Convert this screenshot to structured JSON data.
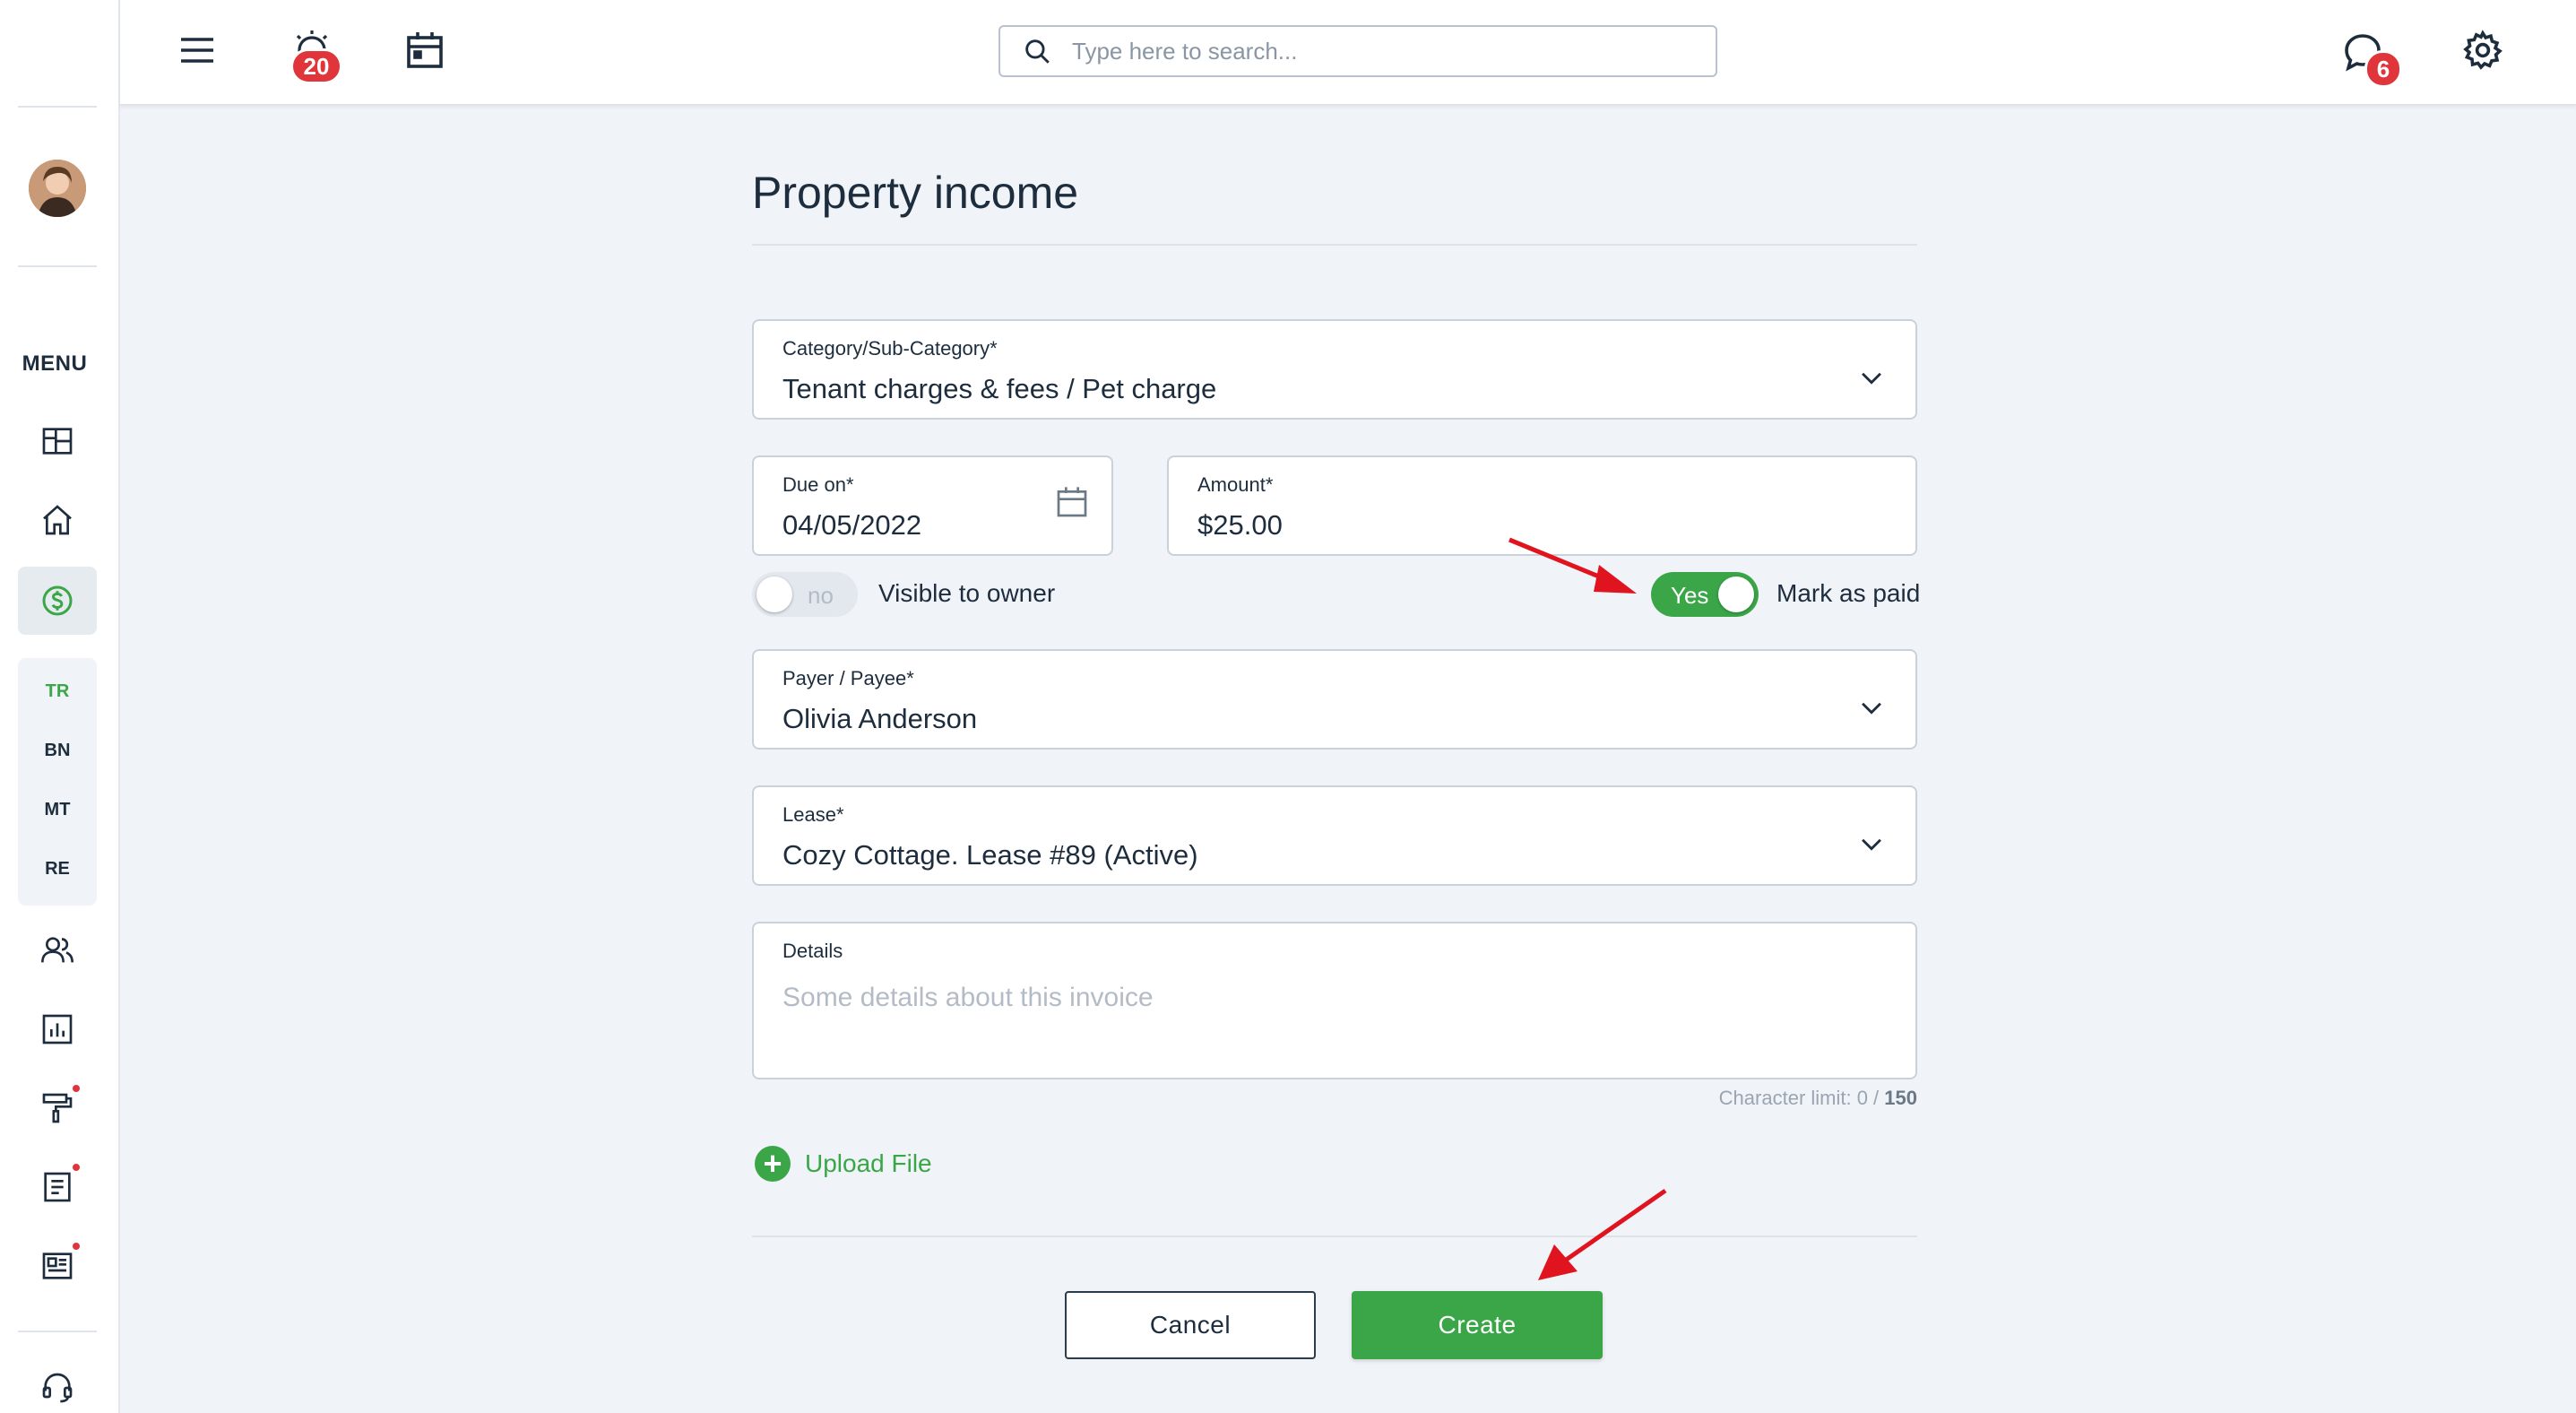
{
  "header": {
    "alerts_badge": "20",
    "messages_badge": "6",
    "search_placeholder": "Type here to search..."
  },
  "sidebar": {
    "menu_label": "MENU",
    "sub_items": [
      "TR",
      "BN",
      "MT",
      "RE"
    ]
  },
  "form": {
    "title": "Property income",
    "category": {
      "label": "Category/Sub-Category*",
      "value": "Tenant charges & fees / Pet charge"
    },
    "due_on": {
      "label": "Due on*",
      "value": "04/05/2022"
    },
    "amount": {
      "label": "Amount*",
      "value": "$25.00"
    },
    "visible_to_owner": {
      "toggle_text": "no",
      "label": "Visible to owner",
      "state": false
    },
    "mark_as_paid": {
      "toggle_text": "Yes",
      "label": "Mark as paid",
      "state": true
    },
    "payer": {
      "label": "Payer / Payee*",
      "value": "Olivia Anderson"
    },
    "lease": {
      "label": "Lease*",
      "value": "Cozy Cottage. Lease #89 (Active)"
    },
    "details": {
      "label": "Details",
      "placeholder": "Some details about this invoice"
    },
    "char_limit": {
      "prefix": "Character limit: 0 / ",
      "max": "150"
    },
    "upload_label": "Upload File",
    "cancel_label": "Cancel",
    "create_label": "Create"
  },
  "colors": {
    "accent": "#3aa648",
    "badge": "#e0353b",
    "annotation_arrow": "#e0141e"
  }
}
